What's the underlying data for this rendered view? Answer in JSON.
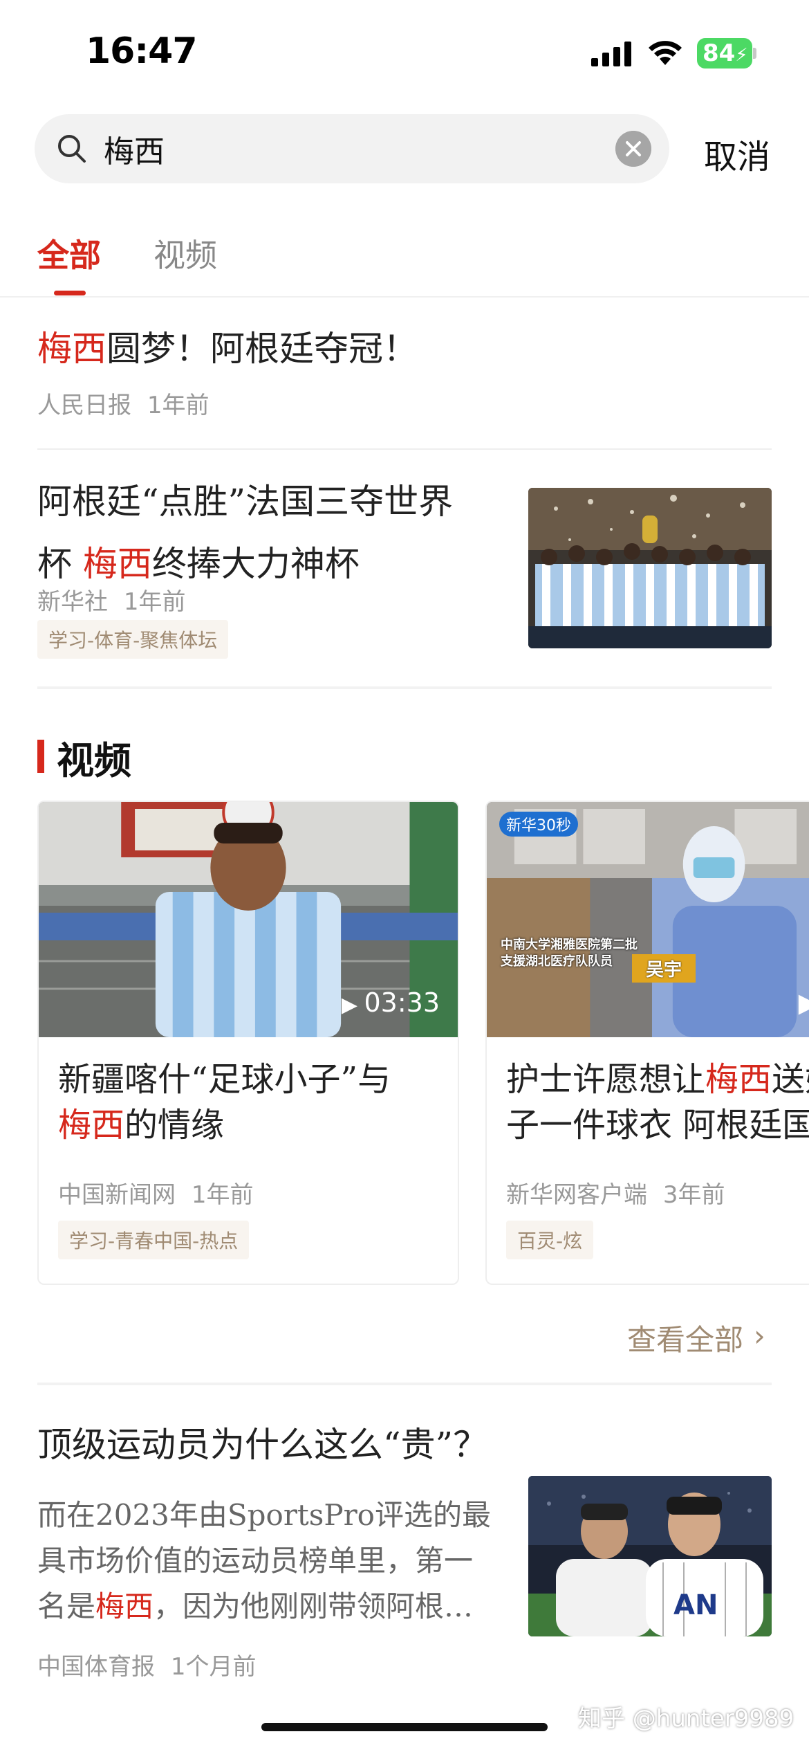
{
  "status_bar": {
    "time": "16:47",
    "battery": "84"
  },
  "search": {
    "query": "梅西",
    "cancel_label": "取消"
  },
  "tabs": [
    {
      "label": "全部",
      "active": true
    },
    {
      "label": "视频",
      "active": false
    }
  ],
  "articles": [
    {
      "title_hl": "梅西",
      "title_rest": "圆梦！阿根廷夺冠！",
      "source": "人民日报",
      "time": "1年前"
    },
    {
      "title_line1": "阿根廷“点胜”法国三夺世界",
      "title_line2_pre": "杯 ",
      "title_line2_hl": "梅西",
      "title_line2_post": "终捧大力神杯",
      "source": "新华社",
      "time": "1年前",
      "tag": "学习-体育-聚焦体坛",
      "thumbnail_icon": "team-celebration-photo"
    }
  ],
  "video_section": {
    "title": "视频",
    "cards": [
      {
        "title_line1": "新疆喀什“足球小子”与",
        "title_line2_hl": "梅西",
        "title_line2_post": "的情缘",
        "duration": "03:33",
        "source": "中国新闻网",
        "time": "1年前",
        "tag": "学习-青春中国-热点"
      },
      {
        "title_line1_pre": "护士许愿想让",
        "title_line1_hl": "梅西",
        "title_line1_post": "送她",
        "title_line2": "子一件球衣 阿根廷国",
        "source": "新华网客户端",
        "time": "3年前",
        "tag": "百灵-炫",
        "thumb_logo": "新华30秒",
        "thumb_caption1": "中南大学湘雅医院第二批",
        "thumb_caption2": "支援湖北医疗队队员",
        "thumb_name": "吴宇"
      }
    ],
    "see_all": "查看全部"
  },
  "article3": {
    "title": "顶级运动员为什么这么“贵”？",
    "summary_line1": "而在2023年由SportsPro评选的最",
    "summary_line2": "具市场价值的运动员榜单里，第一",
    "summary_line3_pre": "名是",
    "summary_line3_hl": "梅西",
    "summary_line3_post": "，因为他刚刚带领阿根…",
    "source": "中国体育报",
    "time": "1个月前",
    "thumbnail_icon": "baseball-players-photo"
  },
  "watermark": "知乎 @hunter9989",
  "colors": {
    "accent": "#d6281c",
    "tag_text": "#a08b73",
    "tag_bg": "#f8f4ef",
    "meta": "#999999"
  }
}
